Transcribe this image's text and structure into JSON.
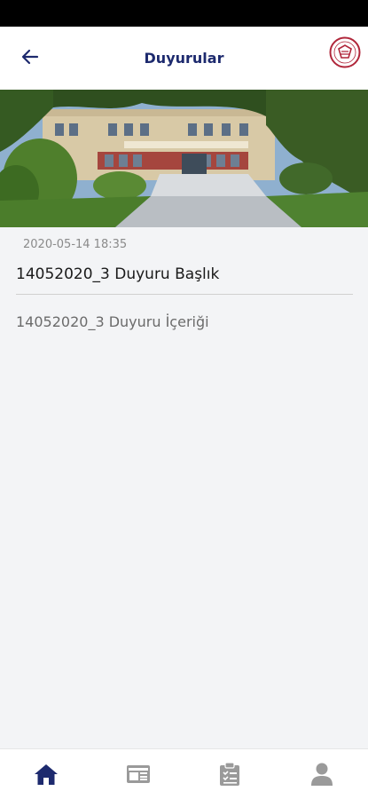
{
  "header": {
    "title": "Duyurular",
    "back_icon": "arrow-left-icon",
    "logo_icon": "institution-logo"
  },
  "announcement": {
    "date": "2020-05-14 18:35",
    "title": "14052020_3 Duyuru Başlık",
    "body": "14052020_3 Duyuru İçeriği"
  },
  "bottom_nav": {
    "items": [
      {
        "icon": "home-icon",
        "active": true
      },
      {
        "icon": "news-icon",
        "active": false
      },
      {
        "icon": "clipboard-icon",
        "active": false
      },
      {
        "icon": "user-icon",
        "active": false
      }
    ]
  },
  "colors": {
    "brand": "#1d2a6e",
    "nav_inactive": "#9a9a9a",
    "background": "#f3f4f6"
  }
}
